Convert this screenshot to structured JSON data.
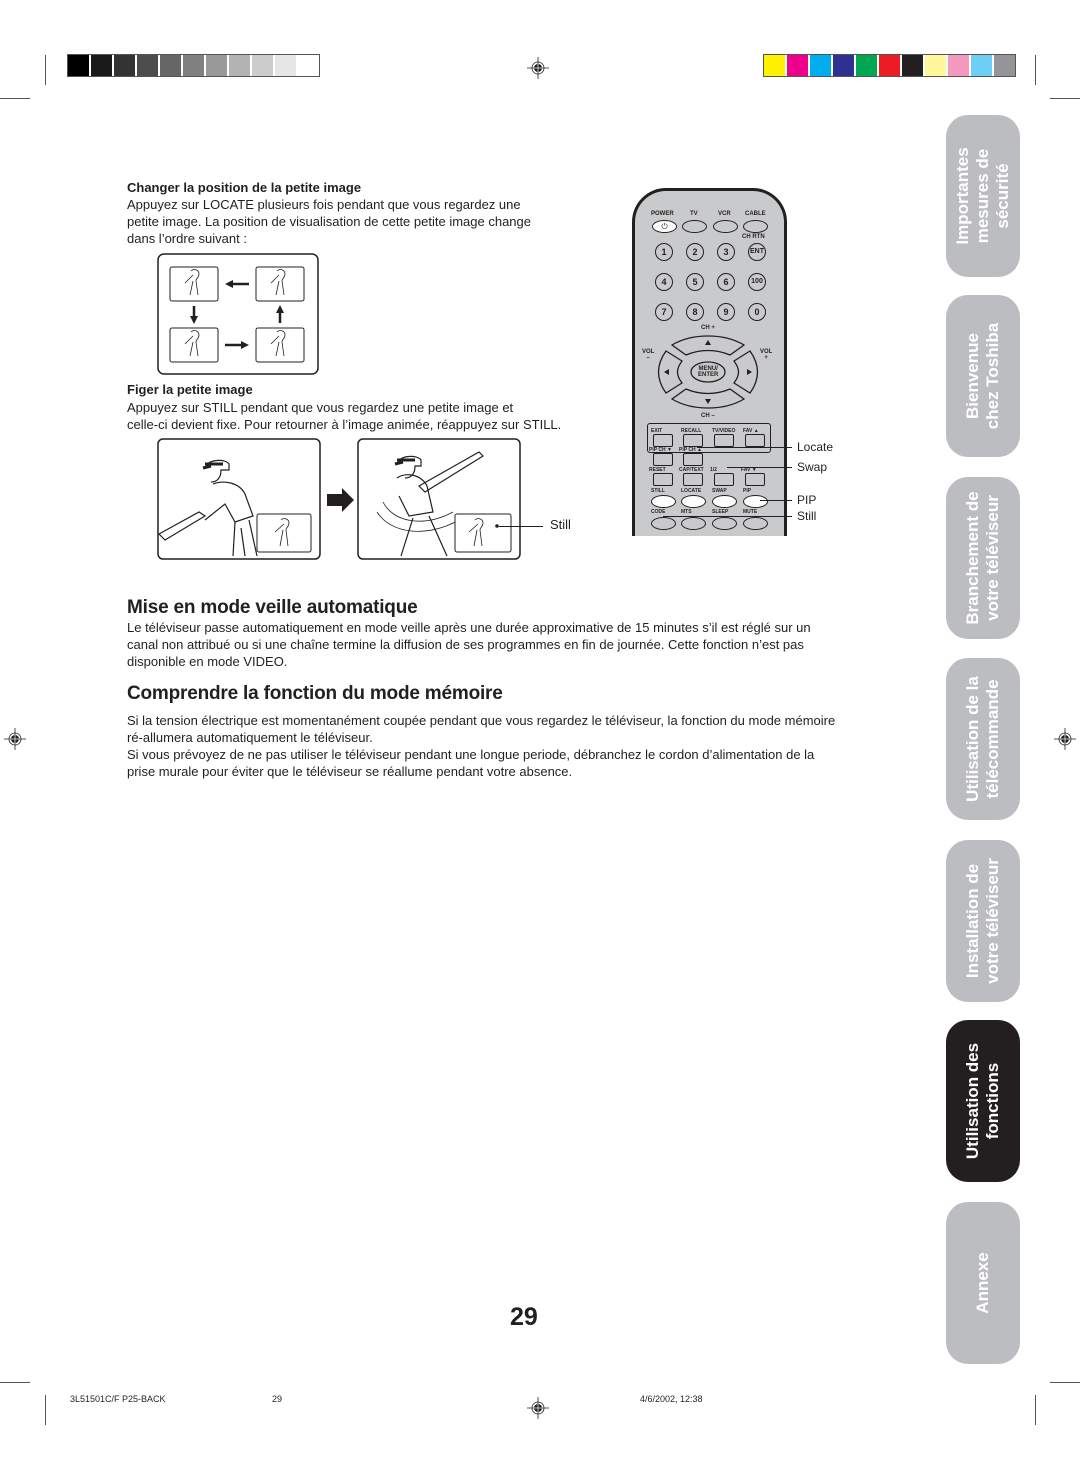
{
  "print_marks": {
    "grayscale_swatches": [
      "#000000",
      "#1a1a1a",
      "#333333",
      "#4d4d4d",
      "#666666",
      "#808080",
      "#999999",
      "#b3b3b3",
      "#cccccc",
      "#e6e6e6",
      "#ffffff"
    ],
    "color_swatches": [
      "#fff200",
      "#ec008c",
      "#00aeef",
      "#2e3192",
      "#00a651",
      "#ed1c24",
      "#231f20",
      "#fff799",
      "#f49ac1",
      "#6dcff6",
      "#939598"
    ]
  },
  "section_locate": {
    "heading": "Changer la position de la petite image",
    "body": [
      "Appuyez sur LOCATE plusieurs fois pendant que vous regardez une",
      "petite image. La position de visualisation de cette petite image change",
      "dans l’ordre suivant :"
    ]
  },
  "section_still": {
    "heading": "Figer la petite image",
    "body": [
      "Appuyez sur STILL pendant que vous regardez une petite image et",
      "celle-ci devient fixe. Pour retourner à l’image animée, réappuyez sur STILL."
    ],
    "still_label": "Still"
  },
  "remote": {
    "top_labels": [
      "POWER",
      "TV",
      "VCR",
      "CABLE"
    ],
    "ch_rtn": "CH RTN",
    "digits": [
      "1",
      "2",
      "3",
      "ENT",
      "4",
      "5",
      "6",
      "100",
      "7",
      "8",
      "9",
      "0"
    ],
    "ch_plus": "CH +",
    "ch_minus": "CH –",
    "vol_minus": "VOL\n–",
    "vol_plus": "VOL\n+",
    "menu_enter": "MENU/\nENTER",
    "row1_labels": [
      "EXIT",
      "RECALL",
      "TV/VIDEO",
      "FAV ▲"
    ],
    "row2_labels": [
      "PIP CH ▼",
      "PIP CH ▲"
    ],
    "row3_labels": [
      "RESET",
      "CAP/TEXT",
      "1/2",
      "FAV ▼"
    ],
    "row4_labels": [
      "STILL",
      "LOCATE",
      "SWAP",
      "PIP"
    ],
    "row5_labels": [
      "CODE",
      "MTS",
      "SLEEP",
      "MUTE"
    ],
    "callouts": {
      "locate": "Locate",
      "swap": "Swap",
      "pip": "PIP",
      "still": "Still"
    }
  },
  "section_sleep": {
    "title": "Mise en mode veille automatique",
    "body": [
      "Le téléviseur passe automatiquement en mode veille après une durée approximative de 15 minutes s’il est réglé sur un",
      "canal non attribué ou si une chaîne termine la diffusion de ses programmes en fin de journée. Cette fonction n’est pas",
      "disponible en mode VIDEO."
    ]
  },
  "section_memory": {
    "title": "Comprendre la fonction du mode mémoire",
    "body": [
      "Si la tension électrique est momentanément coupée pendant que vous regardez le téléviseur, la fonction du mode mémoire",
      "ré-allumera automatiquement le téléviseur.",
      "Si vous prévoyez de ne pas utiliser le téléviseur pendant une longue periode, débranchez le cordon d’alimentation de la",
      "prise murale pour éviter que le téléviseur se réallume pendant votre absence."
    ]
  },
  "tabs": [
    {
      "lines": [
        "Importantes",
        "mesures de",
        "sécurité"
      ],
      "active": false
    },
    {
      "lines": [
        "Bienvenue",
        "chez Toshiba"
      ],
      "active": false
    },
    {
      "lines": [
        "Branchement de",
        "votre téléviseur"
      ],
      "active": false
    },
    {
      "lines": [
        "Utilisation de la",
        "télécommande"
      ],
      "active": false
    },
    {
      "lines": [
        "Installation de",
        "votre téléviseur"
      ],
      "active": false
    },
    {
      "lines": [
        "Utilisation des",
        "fonctions"
      ],
      "active": true
    },
    {
      "lines": [
        "Annexe"
      ],
      "active": false
    }
  ],
  "page_number": "29",
  "footer": {
    "job": "3L51501C/F P25-BACK",
    "page": "29",
    "date": "4/6/2002, 12:38"
  }
}
